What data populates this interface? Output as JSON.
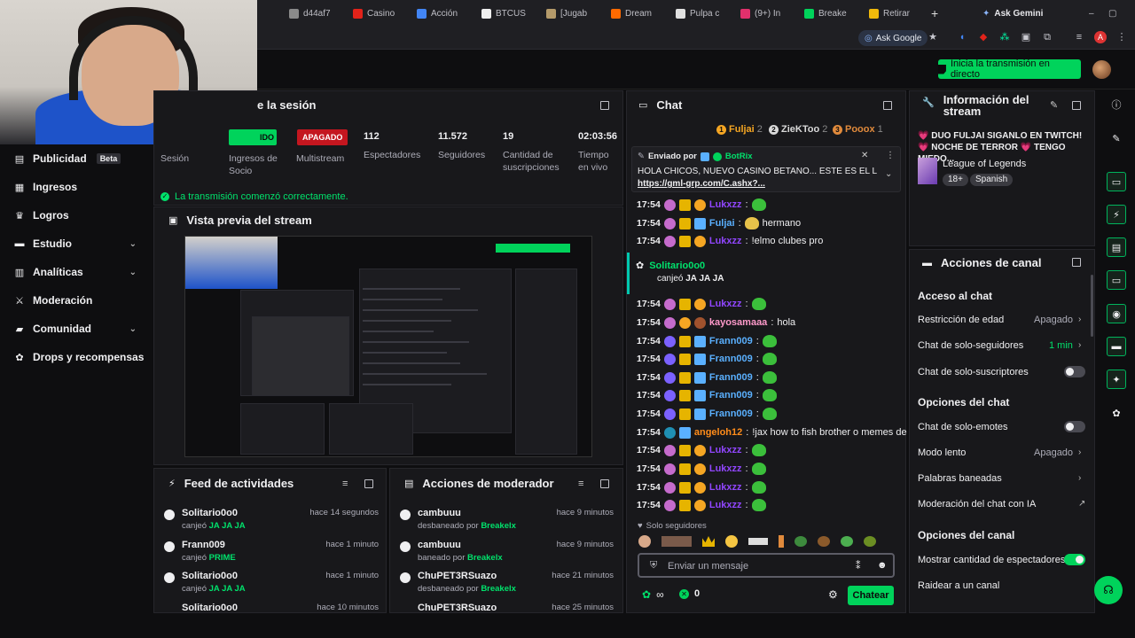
{
  "browser": {
    "tabs": [
      {
        "label": "d44af7",
        "color": "#8a8a8a"
      },
      {
        "label": "Casino",
        "color": "#e2231a"
      },
      {
        "label": "Acción",
        "color": "#4285f4"
      },
      {
        "label": "BTCUS",
        "color": "#efefef"
      },
      {
        "label": "[Jugab",
        "color": "#b49a6a"
      },
      {
        "label": "Dream",
        "color": "#ff6a00"
      },
      {
        "label": "Pulpa c",
        "color": "#e0e0e0"
      },
      {
        "label": "(9+) In",
        "color": "#e1306c"
      },
      {
        "label": "Breake",
        "color": "#00d35b"
      },
      {
        "label": "Retirar",
        "color": "#f0b90b"
      }
    ],
    "new_tab": "+",
    "ask_gemini": "Ask Gemini",
    "ask_google": "Ask Google"
  },
  "topbar": {
    "go_live": "Inicia la transmisión en directo"
  },
  "leftnav": {
    "items": [
      {
        "label": "Publicidad",
        "badge": "Beta",
        "icon": "megaphone-icon"
      },
      {
        "label": "Ingresos",
        "icon": "money-icon"
      },
      {
        "label": "Logros",
        "icon": "trophy-icon"
      },
      {
        "label": "Estudio",
        "icon": "studio-icon",
        "chevron": "⌄"
      },
      {
        "label": "Analíticas",
        "icon": "chart-icon",
        "chevron": "⌄"
      },
      {
        "label": "Moderación",
        "icon": "sword-icon"
      },
      {
        "label": "Comunidad",
        "icon": "community-icon",
        "chevron": "⌄"
      },
      {
        "label": "Drops y recompensas",
        "icon": "gift-icon"
      }
    ]
  },
  "session": {
    "title_partial": "e la sesión",
    "live_badge": "IDO",
    "offline_badge": "APAGADO",
    "labels": [
      "Sesión",
      "Ingresos de Socio",
      "Multistream",
      "Espectadores",
      "Seguidores",
      "Cantidad de suscripciones",
      "Tiempo en vivo"
    ],
    "values": {
      "viewers": "112",
      "followers": "11.572",
      "subs": "19",
      "time": "02:03:56"
    },
    "status": "La transmisión comenzó correctamente."
  },
  "preview": {
    "title": "Vista previa del stream"
  },
  "feed": {
    "title": "Feed de actividades",
    "rows": [
      {
        "name": "Solitario0o0",
        "action": "canjeó",
        "value": "JA JA JA",
        "time": "hace 14 segundos"
      },
      {
        "name": "Frann009",
        "action": "canjeó",
        "value": "PRIME",
        "time": "hace 1 minuto"
      },
      {
        "name": "Solitario0o0",
        "action": "canjeó",
        "value": "JA JA JA",
        "time": "hace 1 minuto"
      },
      {
        "name": "Solitario0o0",
        "action": "",
        "value": "",
        "time": "hace 10 minutos"
      }
    ]
  },
  "modactions": {
    "title": "Acciones de moderador",
    "rows": [
      {
        "name": "cambuuu",
        "action": "desbaneado por",
        "by": "Breakelx",
        "time": "hace 9 minutos"
      },
      {
        "name": "cambuuu",
        "action": "baneado por",
        "by": "Breakelx",
        "time": "hace 9 minutos"
      },
      {
        "name": "ChuPET3RSuazo",
        "action": "desbaneado por",
        "by": "Breakelx",
        "time": "hace 21 minutos"
      },
      {
        "name": "ChuPET3RSuazo",
        "action": "",
        "by": "",
        "time": "hace 25 minutos"
      }
    ]
  },
  "chat": {
    "title": "Chat",
    "top": [
      {
        "rank": "1",
        "name": "Fuljai",
        "count": "2",
        "color": "#f5a623"
      },
      {
        "rank": "2",
        "name": "ZieKToo",
        "count": "2",
        "color": "#d9d9d9"
      },
      {
        "rank": "3",
        "name": "Pooox",
        "count": "1",
        "color": "#e08a3c"
      }
    ],
    "pinned": {
      "sent_by": "Enviado por",
      "bot": "BotRix",
      "text": "HOLA CHICOS, NUEVO CASINO BETANO... ESTE ES EL LINK",
      "link": "https://gml-grp.com/C.ashx?..."
    },
    "messages": [
      {
        "time": "17:54",
        "user": "Lukxzz",
        "color": "#9146ff",
        "text": "",
        "emote": true
      },
      {
        "time": "17:54",
        "user": "Fuljai",
        "color": "#5ab0ff",
        "text": "hermano",
        "emote": true
      },
      {
        "time": "17:54",
        "user": "Lukxzz",
        "color": "#9146ff",
        "text": "!elmo clubes pro",
        "emote": false
      },
      {
        "time": "17:54",
        "user": "Lukxzz",
        "color": "#9146ff",
        "text": "",
        "emote": true
      },
      {
        "time": "17:54",
        "user": "kayosamaaa",
        "color": "#ff9acb",
        "text": "hola",
        "emote": false
      },
      {
        "time": "17:54",
        "user": "Frann009",
        "color": "#5ab0ff",
        "text": "",
        "emote": true
      },
      {
        "time": "17:54",
        "user": "Frann009",
        "color": "#5ab0ff",
        "text": "",
        "emote": true
      },
      {
        "time": "17:54",
        "user": "Frann009",
        "color": "#5ab0ff",
        "text": "",
        "emote": true
      },
      {
        "time": "17:54",
        "user": "Frann009",
        "color": "#5ab0ff",
        "text": "",
        "emote": true
      },
      {
        "time": "17:54",
        "user": "Frann009",
        "color": "#5ab0ff",
        "text": "",
        "emote": true
      },
      {
        "time": "17:54",
        "user": "angeloh12",
        "color": "#ff8c1a",
        "text": "!jax how to fish brother o memes de ig",
        "emote": false
      },
      {
        "time": "17:54",
        "user": "Lukxzz",
        "color": "#9146ff",
        "text": "",
        "emote": true
      },
      {
        "time": "17:54",
        "user": "Lukxzz",
        "color": "#9146ff",
        "text": "",
        "emote": true
      },
      {
        "time": "17:54",
        "user": "Lukxzz",
        "color": "#9146ff",
        "text": "",
        "emote": true
      },
      {
        "time": "17:54",
        "user": "Lukxzz",
        "color": "#9146ff",
        "text": "",
        "emote": true
      }
    ],
    "redeem": {
      "user": "Solitario0o0",
      "action": "canjeó",
      "value": "JA JA JA"
    },
    "followers_only": "Solo seguidores",
    "input_placeholder": "Enviar un mensaje",
    "points": "∞",
    "bits": "0",
    "send": "Chatear"
  },
  "streaminfo": {
    "title": "Información del stream",
    "stream_title": "💗 DUO FULJAI SIGANLO EN TWITCH! 💗 NOCHE DE TERROR 💗 TENGO MIEDO...",
    "game": "League of Legends",
    "tags": [
      "18+",
      "Spanish"
    ]
  },
  "channel": {
    "title": "Acciones de canal",
    "sections": {
      "chat_access": "Acceso al chat",
      "chat_options": "Opciones del chat",
      "channel_options": "Opciones del canal"
    },
    "rows": {
      "age": {
        "label": "Restricción de edad",
        "value": "Apagado"
      },
      "followers": {
        "label": "Chat de solo-seguidores",
        "value": "1 min"
      },
      "subs": {
        "label": "Chat de solo-suscriptores"
      },
      "emotes": {
        "label": "Chat de solo-emotes"
      },
      "slow": {
        "label": "Modo lento",
        "value": "Apagado"
      },
      "banned": {
        "label": "Palabras baneadas"
      },
      "ai": {
        "label": "Moderación del chat con IA"
      },
      "viewers": {
        "label": "Mostrar cantidad de espectadores"
      },
      "raid": {
        "label": "Raidear a un canal"
      }
    }
  }
}
